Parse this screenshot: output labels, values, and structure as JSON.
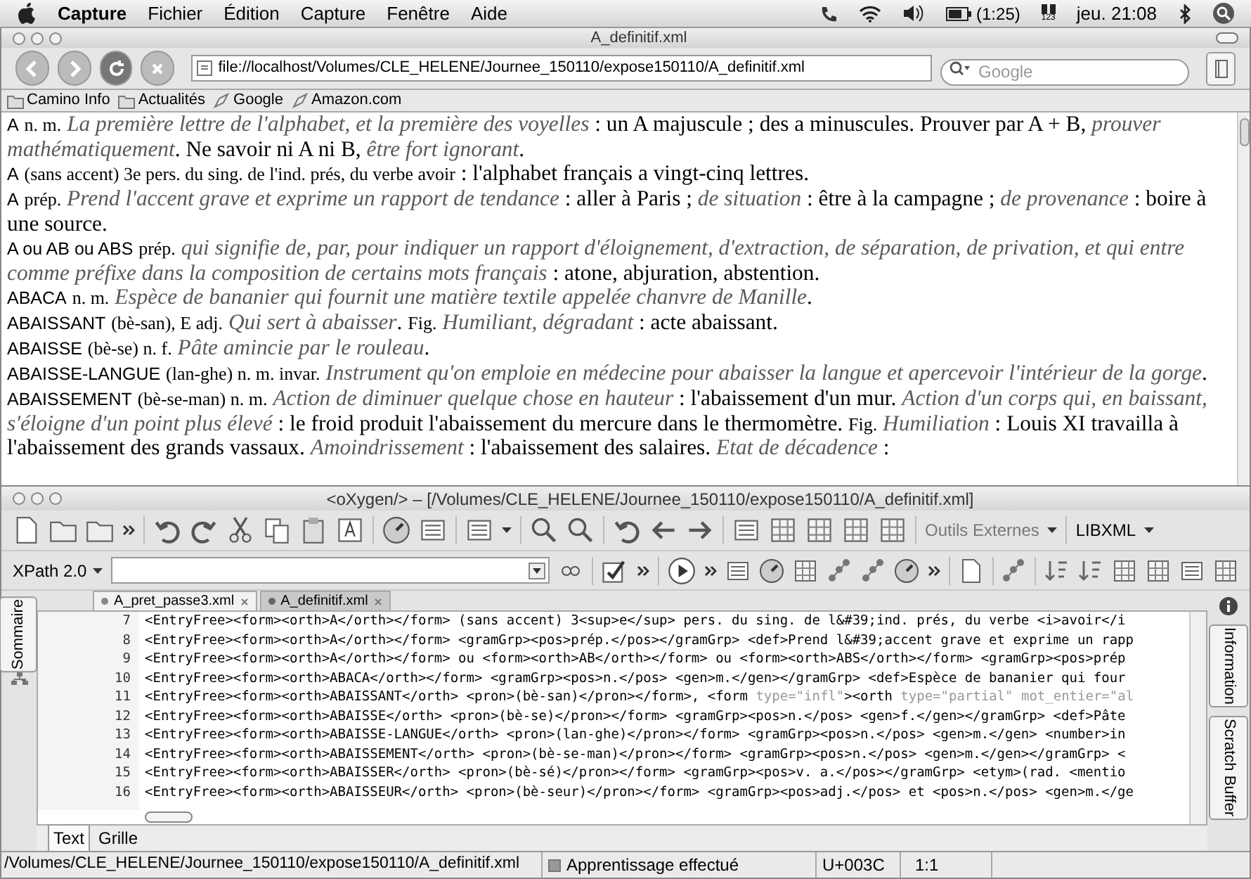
{
  "menubar": {
    "items": [
      {
        "label": "Capture",
        "kind": "app"
      },
      {
        "label": "Fichier",
        "kind": "menu"
      },
      {
        "label": "Édition",
        "kind": "menu"
      },
      {
        "label": "Capture",
        "kind": "menu"
      },
      {
        "label": "Fenêtre",
        "kind": "menu"
      },
      {
        "label": "Aide",
        "kind": "menu"
      }
    ],
    "battery": "(1:25)",
    "input_source": "123",
    "clock": "jeu. 21:08"
  },
  "browser": {
    "title": "A_definitif.xml",
    "url": "file://localhost/Volumes/CLE_HELENE/Journee_150110/expose150110/A_definitif.xml",
    "search": {
      "placeholder": "Google"
    },
    "bookmarks": [
      {
        "label": "Camino Info",
        "kind": "folder"
      },
      {
        "label": "Actualités",
        "kind": "folder"
      },
      {
        "label": "Google",
        "kind": "link"
      },
      {
        "label": "Amazon.com",
        "kind": "link"
      }
    ],
    "entries": [
      [
        {
          "kind": "head",
          "text": "A"
        },
        {
          "kind": "gram",
          "text": "n. m."
        },
        {
          "kind": "def",
          "text": "La première lettre de l'alphabet, et la première des voyelles"
        },
        {
          "kind": "ex",
          "text": " : un A majuscule ; des a minuscules. Prouver par A + B, "
        },
        {
          "kind": "def",
          "text": "prouver mathématiquement"
        },
        {
          "kind": "ex",
          "text": ". Ne savoir ni A ni B, "
        },
        {
          "kind": "def",
          "text": "être fort ignorant"
        },
        {
          "kind": "ex",
          "text": "."
        }
      ],
      [
        {
          "kind": "head",
          "text": "A"
        },
        {
          "kind": "gram",
          "text": "(sans accent) 3e pers. du sing. de l'ind. prés, du verbe avoir"
        },
        {
          "kind": "ex",
          "text": " : l'alphabet français a vingt-cinq lettres."
        }
      ],
      [
        {
          "kind": "head",
          "text": "A"
        },
        {
          "kind": "gram",
          "text": "prép."
        },
        {
          "kind": "def",
          "text": "Prend l'accent grave et exprime un rapport de tendance"
        },
        {
          "kind": "ex",
          "text": " : aller à Paris ; "
        },
        {
          "kind": "def",
          "text": "de situation"
        },
        {
          "kind": "ex",
          "text": " : être à la campagne ; "
        },
        {
          "kind": "def",
          "text": "de provenance"
        },
        {
          "kind": "ex",
          "text": " : boire à une source."
        }
      ],
      [
        {
          "kind": "head",
          "text": "A ou AB ou ABS"
        },
        {
          "kind": "gram",
          "text": "prép."
        },
        {
          "kind": "def",
          "text": "qui signifie de, par, pour indiquer un rapport d'éloignement, d'extraction, de séparation, de privation, et qui entre comme préfixe dans la composition de certains mots français"
        },
        {
          "kind": "ex",
          "text": " : atone, abjuration, abstention."
        }
      ],
      [
        {
          "kind": "head",
          "text": "ABACA"
        },
        {
          "kind": "gram",
          "text": "n. m."
        },
        {
          "kind": "def",
          "text": "Espèce de bananier qui fournit une matière textile appelée chanvre de Manille"
        },
        {
          "kind": "ex",
          "text": "."
        }
      ],
      [
        {
          "kind": "head",
          "text": "ABAISSANT"
        },
        {
          "kind": "gram",
          "text": "(bè-san), E adj."
        },
        {
          "kind": "def",
          "text": "Qui sert à abaisser"
        },
        {
          "kind": "ex",
          "text": ". "
        },
        {
          "kind": "gram",
          "text": "Fig."
        },
        {
          "kind": "def",
          "text": "Humiliant, dégradant"
        },
        {
          "kind": "ex",
          "text": " : acte abaissant."
        }
      ],
      [
        {
          "kind": "head",
          "text": "ABAISSE"
        },
        {
          "kind": "gram",
          "text": "(bè-se) n. f."
        },
        {
          "kind": "def",
          "text": "Pâte amincie par le rouleau"
        },
        {
          "kind": "ex",
          "text": "."
        }
      ],
      [
        {
          "kind": "head",
          "text": "ABAISSE-LANGUE"
        },
        {
          "kind": "gram",
          "text": "(lan-ghe) n. m. invar."
        },
        {
          "kind": "def",
          "text": "Instrument qu'on emploie en médecine pour abaisser la langue et apercevoir l'intérieur de la gorge"
        },
        {
          "kind": "ex",
          "text": "."
        }
      ],
      [
        {
          "kind": "head",
          "text": "ABAISSEMENT"
        },
        {
          "kind": "gram",
          "text": "(bè-se-man) n. m."
        },
        {
          "kind": "def",
          "text": "Action de diminuer quelque chose en hauteur"
        },
        {
          "kind": "ex",
          "text": " : l'abaissement d'un mur. "
        },
        {
          "kind": "def",
          "text": "Action d'un corps qui, en baissant, s'éloigne d'un point plus élevé"
        },
        {
          "kind": "ex",
          "text": " : le froid produit l'abaissement du mercure dans le thermomètre. "
        },
        {
          "kind": "gram",
          "text": "Fig."
        },
        {
          "kind": "def",
          "text": "Humiliation"
        },
        {
          "kind": "ex",
          "text": " : Louis XI travailla à l'abaissement des grands vassaux. "
        },
        {
          "kind": "def",
          "text": "Amoindrissement"
        },
        {
          "kind": "ex",
          "text": " : l'abaissement des salaires. "
        },
        {
          "kind": "def",
          "text": "Etat de décadence"
        },
        {
          "kind": "ex",
          "text": " :"
        }
      ]
    ]
  },
  "editor": {
    "title": "<oXygen/> – [/Volumes/CLE_HELENE/Journee_150110/expose150110/A_definitif.xml]",
    "toolbar_menus": [
      "Outils Externes",
      "LIBXML"
    ],
    "xpath": "XPath 2.0",
    "tabs": [
      {
        "label": "A_pret_passe3.xml",
        "selected": false
      },
      {
        "label": "A_definitif.xml",
        "selected": true
      }
    ],
    "side_tab_left": "Sommaire",
    "side_tabs_right": [
      "Information",
      "Scratch Buffer"
    ],
    "lines": [
      {
        "number": "7",
        "text": "<EntryFree><form><orth>A</orth></form> (sans accent) 3<sup>e</sup> pers. du sing. de l&#39;ind. prés, du verbe <i>avoir</i"
      },
      {
        "number": "8",
        "text": "<EntryFree><form><orth>A</orth></form> <gramGrp><pos>prép.</pos></gramGrp> <def>Prend l&#39;accent grave et exprime un rapp"
      },
      {
        "number": "9",
        "text": "<EntryFree><form><orth>A</orth></form> ou <form><orth>AB</orth></form> ou <form><orth>ABS</orth></form> <gramGrp><pos>prép"
      },
      {
        "number": "10",
        "text": "<EntryFree><form><orth>ABACA</orth></form> <gramGrp><pos>n.</pos> <gen>m.</gen></gramGrp> <def>Espèce de bananier qui four"
      },
      {
        "number": "11",
        "text": "<EntryFree><form><orth>ABAISSANT</orth> <pron>(bè-san)</pron></form>, <form type=\"infl\"><orth type=\"partial\" mot_entier=\"al"
      },
      {
        "number": "12",
        "text": "<EntryFree><form><orth>ABAISSE</orth> <pron>(bè-se)</pron></form> <gramGrp><pos>n.</pos> <gen>f.</gen></gramGrp> <def>Pâte"
      },
      {
        "number": "13",
        "text": "<EntryFree><form><orth>ABAISSE-LANGUE</orth> <pron>(lan-ghe)</pron></form> <gramGrp><pos>n.</pos> <gen>m.</gen> <number>in"
      },
      {
        "number": "14",
        "text": "<EntryFree><form><orth>ABAISSEMENT</orth> <pron>(bè-se-man)</pron></form> <gramGrp><pos>n.</pos> <gen>m.</gen></gramGrp> <"
      },
      {
        "number": "15",
        "text": "<EntryFree><form><orth>ABAISSER</orth> <pron>(bè-sé)</pron></form> <gramGrp><pos>v. a.</pos></gramGrp> <etym>(rad. <mentio"
      },
      {
        "number": "16",
        "text": "<EntryFree><form><orth>ABAISSEUR</orth> <pron>(bè-seur)</pron></form> <gramGrp><pos>adj.</pos> et <pos>n.</pos> <gen>m.</ge"
      }
    ],
    "view_tabs": [
      {
        "label": "Text",
        "selected": true
      },
      {
        "label": "Grille",
        "selected": false
      }
    ],
    "status_bar": {
      "path": "/Volumes/CLE_HELENE/Journee_150110/expose150110/A_definitif.xml",
      "message": "Apprentissage effectué",
      "char": "U+003C",
      "position": "1:1"
    }
  }
}
